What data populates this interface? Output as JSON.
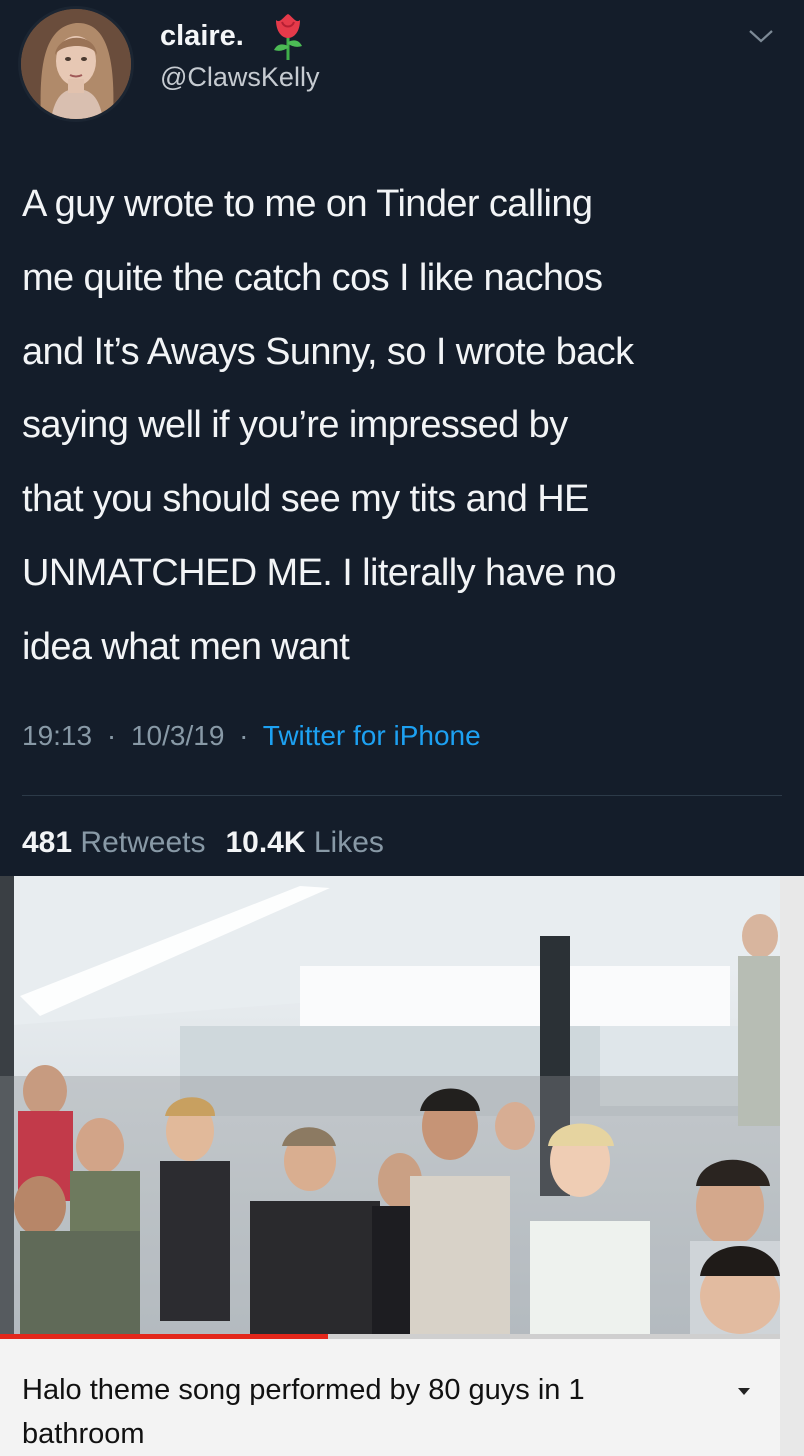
{
  "tweet": {
    "display_name": "claire.",
    "handle": "@ClawsKelly",
    "text_lines": [
      "A guy wrote to me on Tinder calling",
      "me quite the catch cos I like nachos",
      "and It’s Aways Sunny, so I wrote back",
      "saying well if you’re impressed by",
      "that you should see my tits and HE",
      "UNMATCHED ME. I literally have no",
      "idea what men want"
    ],
    "time": "19:13",
    "date": "10/3/19",
    "separator": "·",
    "source": "Twitter for iPhone",
    "retweets_count": "481",
    "retweets_label": "Retweets",
    "likes_count": "10.4K",
    "likes_label": "Likes"
  },
  "video": {
    "title": "Halo theme song performed by 80 guys in 1 bathroom",
    "progress": 0.42
  },
  "colors": {
    "background": "#141d2a",
    "link": "#1da1f2",
    "muted": "#8899a6",
    "progress": "#e3271b"
  },
  "icons": {
    "emoji": "rose-icon",
    "menu": "chevron-down-icon",
    "expand": "caret-down-icon"
  }
}
